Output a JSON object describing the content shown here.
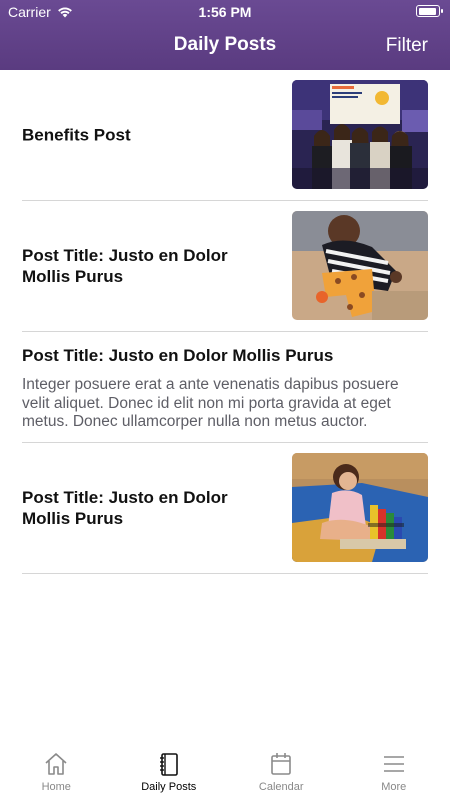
{
  "status_bar": {
    "carrier": "Carrier",
    "time": "1:56 PM",
    "battery_level": 0.9
  },
  "nav": {
    "title": "Daily Posts",
    "filter_label": "Filter"
  },
  "posts": [
    {
      "title": "Benefits Post",
      "image": "photo of a group of women at an event"
    },
    {
      "title": "Post Title: Justo en Dolor Mollis Purus",
      "image": "photo of a child with a giraffe puzzle"
    },
    {
      "title": "Post Title: Justo en Dolor Mollis Purus",
      "excerpt": "Integer posuere erat a ante venenatis dapibus posuere velit aliquet. Donec id elit non mi porta gravida at eget metus. Donec ullamcorper nulla non metus auctor."
    },
    {
      "title": "Post Title: Justo en Dolor Mollis Purus",
      "image": "photo of a child stacking colorful blocks"
    }
  ],
  "tabs": [
    {
      "label": "Home",
      "icon": "home-icon"
    },
    {
      "label": "Daily Posts",
      "icon": "notebook-icon",
      "active": true
    },
    {
      "label": "Calendar",
      "icon": "calendar-icon"
    },
    {
      "label": "More",
      "icon": "menu-icon"
    }
  ],
  "colors": {
    "header": "#5e3f87",
    "text": "#111111",
    "excerpt": "#5e5e66",
    "tab_inactive": "#888888",
    "divider": "#d6d6d6"
  }
}
